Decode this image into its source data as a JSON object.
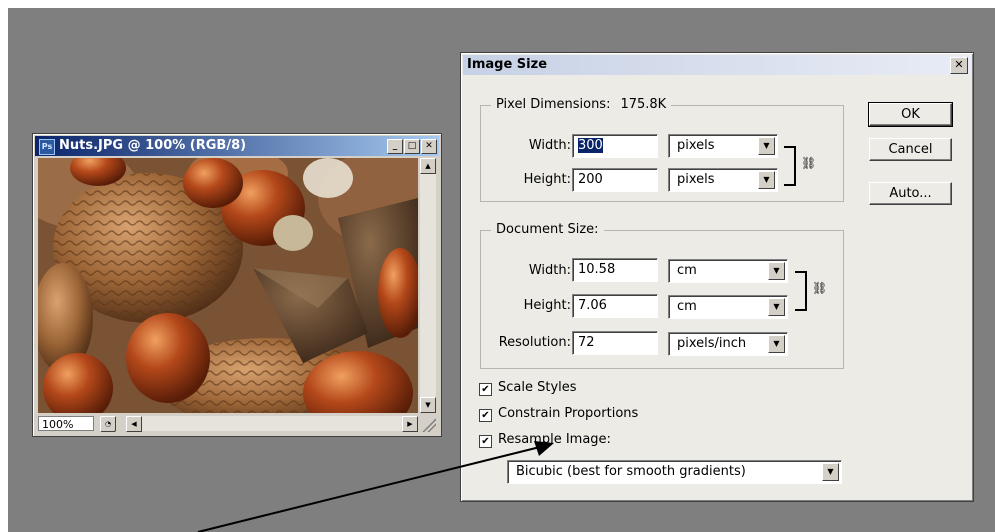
{
  "document_window": {
    "title": "Nuts.JPG @ 100% (RGB/8)",
    "app_icon_text": "Ps",
    "minimize_label": "_",
    "maximize_label": "□",
    "close_label": "✕",
    "zoom_level": "100%",
    "icons": [
      "photoshop-document-icon",
      "minimize-icon",
      "maximize-icon",
      "close-icon",
      "scroll-up-icon",
      "scroll-down-icon",
      "scroll-left-icon",
      "scroll-right-icon",
      "zoom-options-icon",
      "resize-grip-icon"
    ]
  },
  "dialog": {
    "title": "Image Size",
    "close_label": "✕",
    "pixel_dimensions": {
      "legend": "Pixel Dimensions:",
      "size_value": "175.8K",
      "width_label": "Width:",
      "width_value": "300",
      "width_unit": "pixels",
      "height_label": "Height:",
      "height_value": "200",
      "height_unit": "pixels"
    },
    "document_size": {
      "legend": "Document Size:",
      "width_label": "Width:",
      "width_value": "10.58",
      "width_unit": "cm",
      "height_label": "Height:",
      "height_value": "7.06",
      "height_unit": "cm",
      "resolution_label": "Resolution:",
      "resolution_value": "72",
      "resolution_unit": "pixels/inch"
    },
    "options": {
      "scale_styles": {
        "label": "Scale Styles",
        "checked": true
      },
      "constrain_proportions": {
        "label": "Constrain Proportions",
        "checked": true
      },
      "resample_image": {
        "label": "Resample Image:",
        "checked": true
      },
      "resample_method": "Bicubic (best for smooth gradients)"
    },
    "buttons": {
      "ok": "OK",
      "cancel": "Cancel",
      "auto": "Auto..."
    }
  },
  "colors": {
    "workspace": "#7f7f7f",
    "doc_titlebar": "#0a246a",
    "dialog_face": "#ecebe6",
    "annotation_arrow": "#000000"
  }
}
